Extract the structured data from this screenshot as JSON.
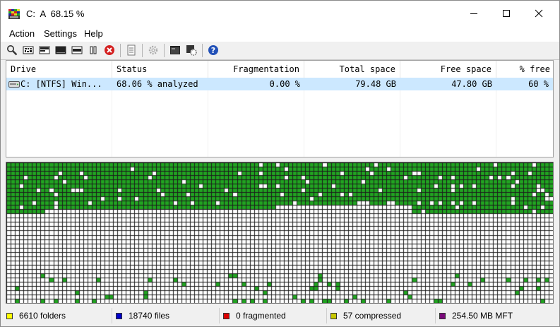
{
  "window": {
    "title": "C:  A  68.15 %"
  },
  "menu": {
    "items": [
      "Action",
      "Settings",
      "Help"
    ]
  },
  "toolbar": {
    "buttons": [
      {
        "name": "analyze-icon"
      },
      {
        "name": "defragment-icon"
      },
      {
        "name": "quick-optimize-icon"
      },
      {
        "name": "full-optimize-icon"
      },
      {
        "name": "optimize-mft-icon"
      },
      {
        "name": "pause-icon"
      },
      {
        "name": "stop-icon"
      },
      {
        "name": "report-icon"
      },
      {
        "name": "preferences-icon"
      },
      {
        "name": "boot-time-scan-icon"
      },
      {
        "name": "boot-script-icon"
      },
      {
        "name": "help-icon"
      }
    ]
  },
  "drives": {
    "columns": [
      "Drive",
      "Status",
      "Fragmentation",
      "Total space",
      "Free space",
      "% free"
    ],
    "rows": [
      {
        "drive": "C: [NTFS]  Win...",
        "status": "68.06 % analyzed",
        "fragmentation": "0.00 %",
        "total": "79.48 GB",
        "free": "47.80 GB",
        "percent_free": "60 %"
      }
    ]
  },
  "cluster_map": {
    "colors": {
      "used": "#21a321",
      "free": "#ffffff",
      "grid": "#1c1c1c"
    },
    "cols": 128,
    "rows": 33
  },
  "status_bar": {
    "folders": {
      "label": "6610 folders",
      "color": "#ffff00"
    },
    "files": {
      "label": "18740 files",
      "color": "#0000cc"
    },
    "fragmented": {
      "label": "0 fragmented",
      "color": "#dd0000"
    },
    "compressed": {
      "label": "57 compressed",
      "color": "#c8c800"
    },
    "mft": {
      "label": "254.50 MB MFT",
      "color": "#7a0a7a"
    }
  }
}
